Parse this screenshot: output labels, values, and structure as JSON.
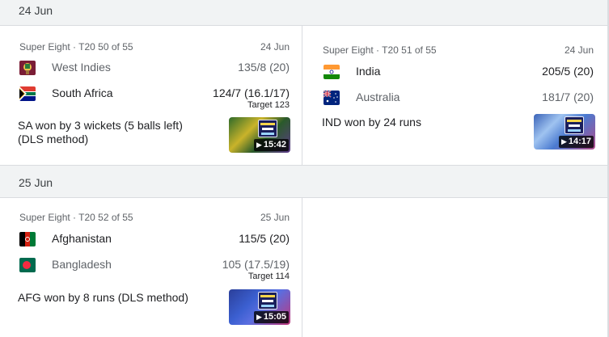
{
  "sections": [
    {
      "date": "24 Jun"
    },
    {
      "date": "25 Jun"
    }
  ],
  "matches": [
    {
      "series": "Super Eight",
      "match_no": "T20 50 of 55",
      "date": "24 Jun",
      "team1": {
        "name": "West Indies",
        "score": "135/8 (20)",
        "flag": "west-indies-flag-icon"
      },
      "team2": {
        "name": "South Africa",
        "score": "124/7 (16.1/17)",
        "target": "Target 123",
        "flag": "south-africa-flag-icon"
      },
      "result_line1": "SA won by 3 wickets (5 balls left)",
      "result_line2": "(DLS method)",
      "video_duration": "15:42"
    },
    {
      "series": "Super Eight",
      "match_no": "T20 51 of 55",
      "date": "24 Jun",
      "team1": {
        "name": "India",
        "score": "205/5 (20)",
        "flag": "india-flag-icon"
      },
      "team2": {
        "name": "Australia",
        "score": "181/7 (20)",
        "flag": "australia-flag-icon"
      },
      "result_line1": "IND won by 24 runs",
      "video_duration": "14:17"
    },
    {
      "series": "Super Eight",
      "match_no": "T20 52 of 55",
      "date": "25 Jun",
      "team1": {
        "name": "Afghanistan",
        "score": "115/5 (20)",
        "flag": "afghanistan-flag-icon"
      },
      "team2": {
        "name": "Bangladesh",
        "score": "105 (17.5/19)",
        "target": "Target 114",
        "flag": "bangladesh-flag-icon"
      },
      "result_line1": "AFG won by 8 runs (DLS method)",
      "video_duration": "15:05"
    }
  ],
  "meta_separator": " · ",
  "play_glyph": "▶",
  "colors": {
    "header_bg": "#f1f3f4",
    "divider": "#dadce0",
    "winner_text": "#202124",
    "loser_text": "#5f6368"
  }
}
